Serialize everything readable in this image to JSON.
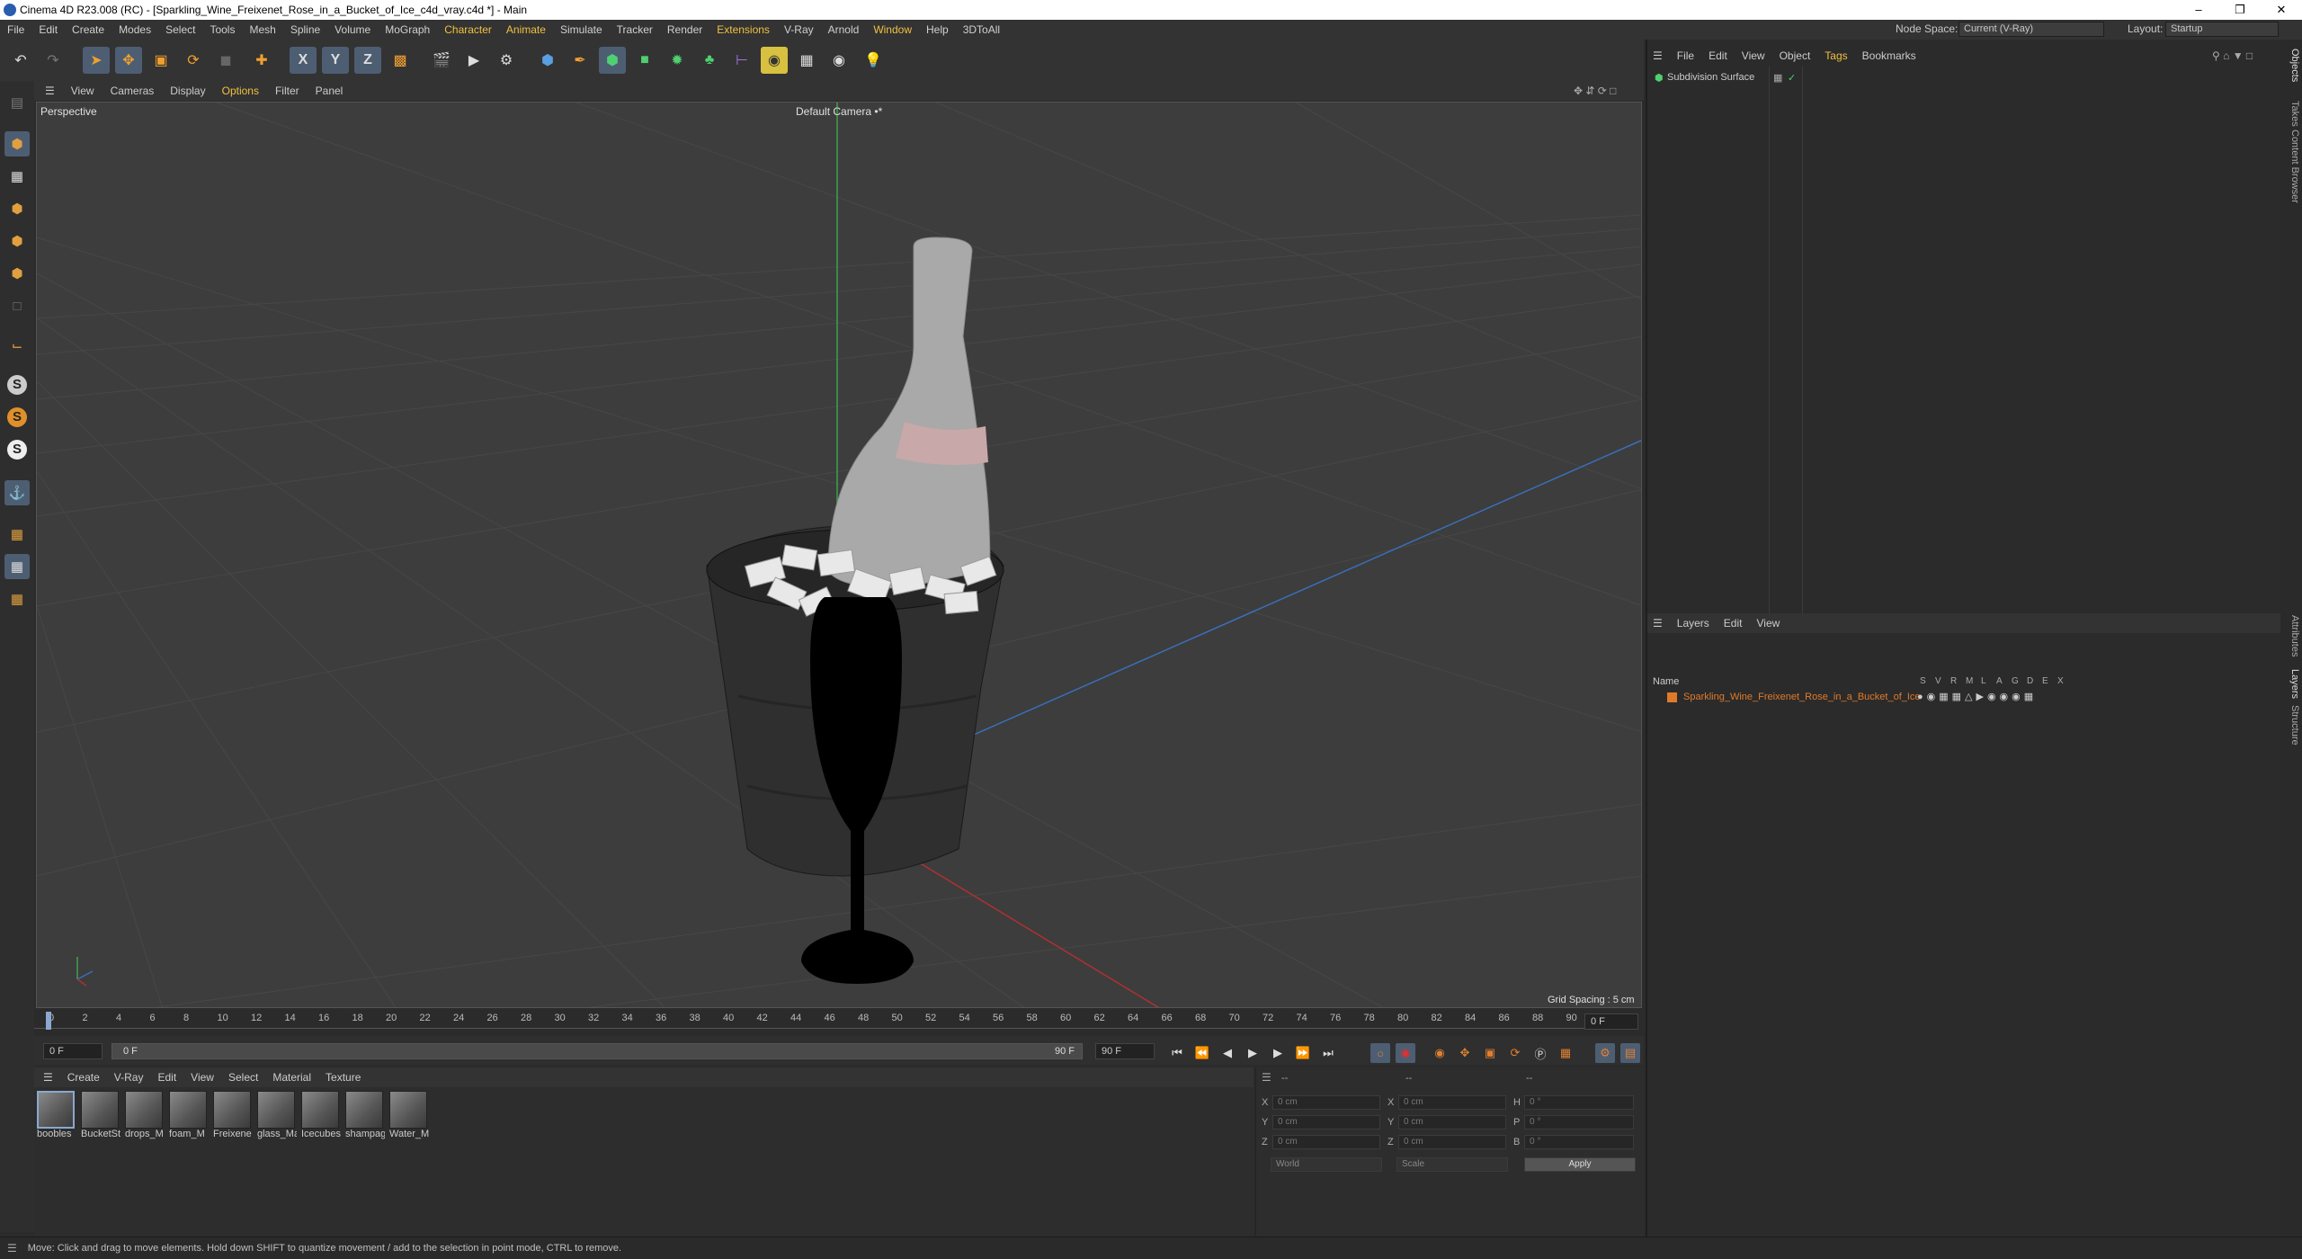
{
  "window": {
    "title": "Cinema 4D R23.008 (RC) - [Sparkling_Wine_Freixenet_Rose_in_a_Bucket_of_Ice_c4d_vray.c4d *] - Main",
    "minimize": "–",
    "maximize": "❐",
    "close": "✕"
  },
  "menubar": {
    "items": [
      "File",
      "Edit",
      "Create",
      "Modes",
      "Select",
      "Tools",
      "Mesh",
      "Spline",
      "Volume",
      "MoGraph",
      "Character",
      "Animate",
      "Simulate",
      "Tracker",
      "Render",
      "Extensions",
      "V-Ray",
      "Arnold",
      "Window",
      "Help",
      "3DToAll"
    ],
    "node_space_label": "Node Space:",
    "node_space_value": "Current (V-Ray)",
    "layout_label": "Layout:",
    "layout_value": "Startup"
  },
  "toolbar": {
    "undo_icon": "undo-icon",
    "redo_icon": "redo-icon",
    "axis_x": "X",
    "axis_y": "Y",
    "axis_z": "Z"
  },
  "viewport": {
    "menu": [
      "View",
      "Cameras",
      "Display",
      "Options",
      "Filter",
      "Panel"
    ],
    "view_label": "Perspective",
    "camera_label": "Default Camera •*",
    "grid_spacing": "Grid Spacing : 5 cm"
  },
  "timeline": {
    "ticks": [
      "0",
      "2",
      "4",
      "6",
      "8",
      "10",
      "12",
      "14",
      "16",
      "18",
      "20",
      "22",
      "24",
      "26",
      "28",
      "30",
      "32",
      "34",
      "36",
      "38",
      "40",
      "42",
      "44",
      "46",
      "48",
      "50",
      "52",
      "54",
      "56",
      "58",
      "60",
      "62",
      "64",
      "66",
      "68",
      "70",
      "72",
      "74",
      "76",
      "78",
      "80",
      "82",
      "84",
      "86",
      "88",
      "90"
    ],
    "current_frame_right": "0 F",
    "start_field": "0 F",
    "range_start": "0 F",
    "range_end": "90 F",
    "end_field": "90 F"
  },
  "materials": {
    "menu": [
      "Create",
      "V-Ray",
      "Edit",
      "View",
      "Select",
      "Material",
      "Texture"
    ],
    "items": [
      "boobles",
      "BucketSt",
      "drops_M",
      "foam_M",
      "Freixene",
      "glass_Ma",
      "Icecubes",
      "shampag",
      "Water_M"
    ]
  },
  "coordinates": {
    "header_dashes": [
      "--",
      "--",
      "--"
    ],
    "rows": [
      {
        "a": "X",
        "av": "0 cm",
        "b": "X",
        "bv": "0 cm",
        "c": "H",
        "cv": "0 °"
      },
      {
        "a": "Y",
        "av": "0 cm",
        "b": "Y",
        "bv": "0 cm",
        "c": "P",
        "cv": "0 °"
      },
      {
        "a": "Z",
        "av": "0 cm",
        "b": "Z",
        "bv": "0 cm",
        "c": "B",
        "cv": "0 °"
      }
    ],
    "space_select": "World",
    "mode_select": "Scale",
    "apply_label": "Apply"
  },
  "objects_panel": {
    "menu": [
      "File",
      "Edit",
      "View",
      "Object",
      "Tags",
      "Bookmarks"
    ],
    "items": [
      {
        "name": "Subdivision Surface"
      }
    ]
  },
  "layers_panel": {
    "menu": [
      "Layers",
      "Edit",
      "View"
    ],
    "header_name": "Name",
    "flags": [
      "S",
      "V",
      "R",
      "M",
      "L",
      "A",
      "G",
      "D",
      "E",
      "X"
    ],
    "items": [
      {
        "name": "Sparkling_Wine_Freixenet_Rose_in_a_Bucket_of_Ice",
        "color": "#e07a2a"
      }
    ]
  },
  "side_tabs": [
    "Objects",
    "Takes",
    "Content Browser",
    "Attributes",
    "Layers",
    "Structure"
  ],
  "status": {
    "text": "Move: Click and drag to move elements. Hold down SHIFT to quantize movement / add to the selection in point mode, CTRL to remove."
  },
  "colors": {
    "accent": "#f0c040",
    "selection": "#4d5e73",
    "layer_text": "#e07a2a",
    "viewport_bg": "#3d3d3d"
  }
}
